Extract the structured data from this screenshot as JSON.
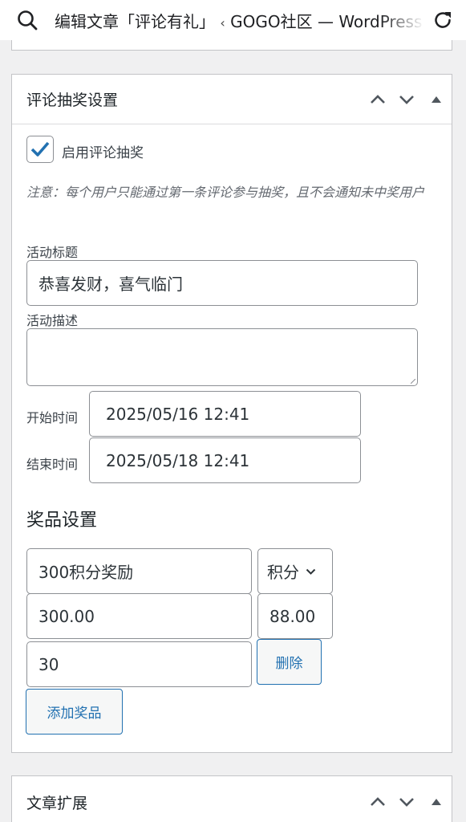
{
  "browser": {
    "title_part1": "编辑文章「评论有礼」",
    "title_sep": "‹",
    "title_part2": "GOGO社区 — WordPress"
  },
  "lottery_box": {
    "title": "评论抽奖设置",
    "enable_label": "启用评论抽奖",
    "enabled": true,
    "note": "注意：每个用户只能通过第一条评论参与抽奖，且不会通知未中奖用户",
    "activity_title_label": "活动标题",
    "activity_title_value": "恭喜发财，喜气临门",
    "activity_desc_label": "活动描述",
    "activity_desc_value": "",
    "start_time_label": "开始时间",
    "start_time_value": "2025/05/16 12:41",
    "end_time_label": "结束时间",
    "end_time_value": "2025/05/18 12:41",
    "prize_section_title": "奖品设置",
    "prize": {
      "name": "300积分奖励",
      "type": "积分",
      "amount": "300.00",
      "probability": "88.00",
      "quantity": "30",
      "delete_label": "删除"
    },
    "add_prize_label": "添加奖品"
  },
  "ext_box": {
    "title": "文章扩展"
  },
  "colors": {
    "accent": "#2271b1",
    "page_bg": "#f0f0f1",
    "border": "#c3c4c7"
  },
  "icons": [
    "search-icon",
    "reload-icon",
    "chevron-up-icon",
    "chevron-down-icon",
    "toggle-arrow-icon",
    "checkmark-icon",
    "select-chevron-icon"
  ]
}
